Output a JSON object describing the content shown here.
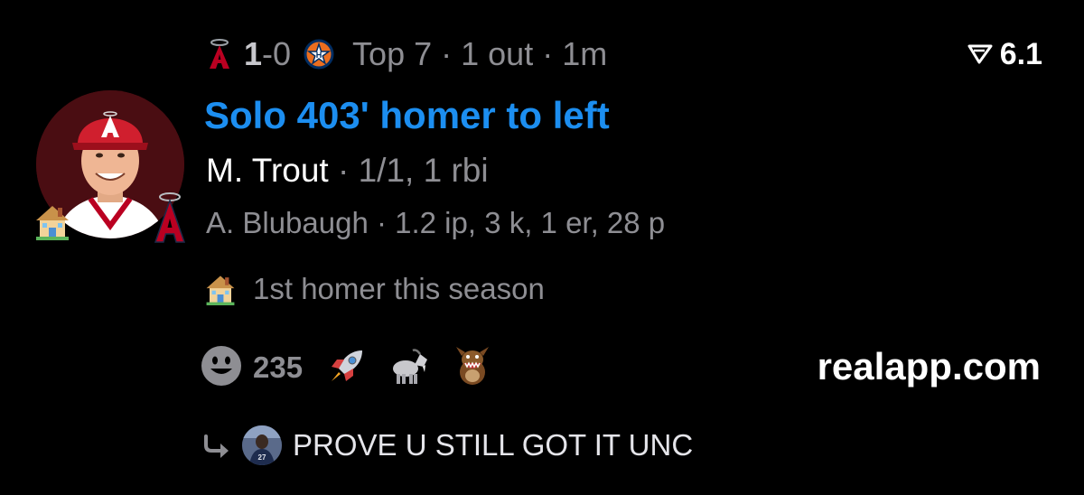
{
  "header": {
    "home_team_icon": "angels-logo-icon",
    "score_lead": "1",
    "score_rest": "-0",
    "away_team_icon": "astros-logo-icon",
    "inning": "Top 7",
    "outs": "1 out",
    "time_ago": "1m"
  },
  "rating": {
    "icon": "flag-triangle-icon",
    "value": "6.1"
  },
  "play": {
    "headline": "Solo 403' homer to left",
    "batter_name": "M. Trout",
    "batter_stats": "· 1/1, 1 rbi",
    "pitcher_line": "A. Blubaugh · 1.2 ip, 3 k, 1 er, 28 p",
    "milestone": "1st homer this season"
  },
  "reactions": {
    "count": "235",
    "items": [
      "smiley-icon",
      "rocket-icon",
      "goat-icon",
      "tasmanian-devil-icon"
    ]
  },
  "brand": "realapp.com",
  "reply": {
    "text": "PROVE U STILL GOT IT UNC"
  },
  "colors": {
    "headline_blue": "#1c8ef0",
    "muted_gray": "#8e8e93",
    "angels_red": "#ba0021",
    "background": "#000000"
  }
}
